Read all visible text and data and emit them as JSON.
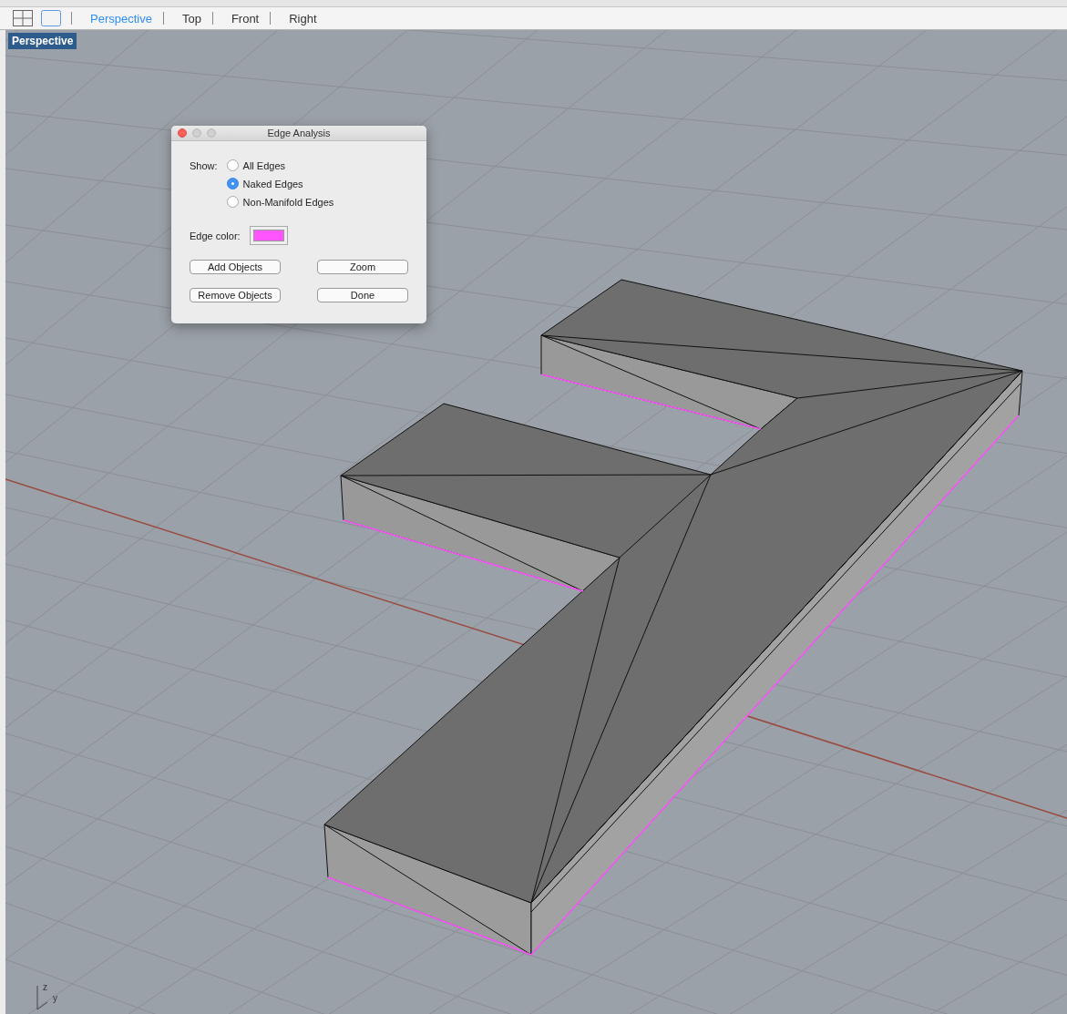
{
  "toolbar": {
    "tabs": [
      {
        "label": "Perspective",
        "selected": true
      },
      {
        "label": "Top",
        "selected": false
      },
      {
        "label": "Front",
        "selected": false
      },
      {
        "label": "Right",
        "selected": false
      }
    ]
  },
  "viewport": {
    "label": "Perspective",
    "axis_labels": [
      "z",
      "y"
    ]
  },
  "dialog": {
    "title": "Edge Analysis",
    "show_label": "Show:",
    "options": [
      {
        "label": "All Edges",
        "selected": false
      },
      {
        "label": "Naked Edges",
        "selected": true
      },
      {
        "label": "Non-Manifold Edges",
        "selected": false
      }
    ],
    "edge_color": {
      "label": "Edge color:",
      "color": "#ff55ff"
    },
    "buttons": [
      "Add Objects",
      "Zoom",
      "Remove Objects",
      "Done"
    ]
  }
}
